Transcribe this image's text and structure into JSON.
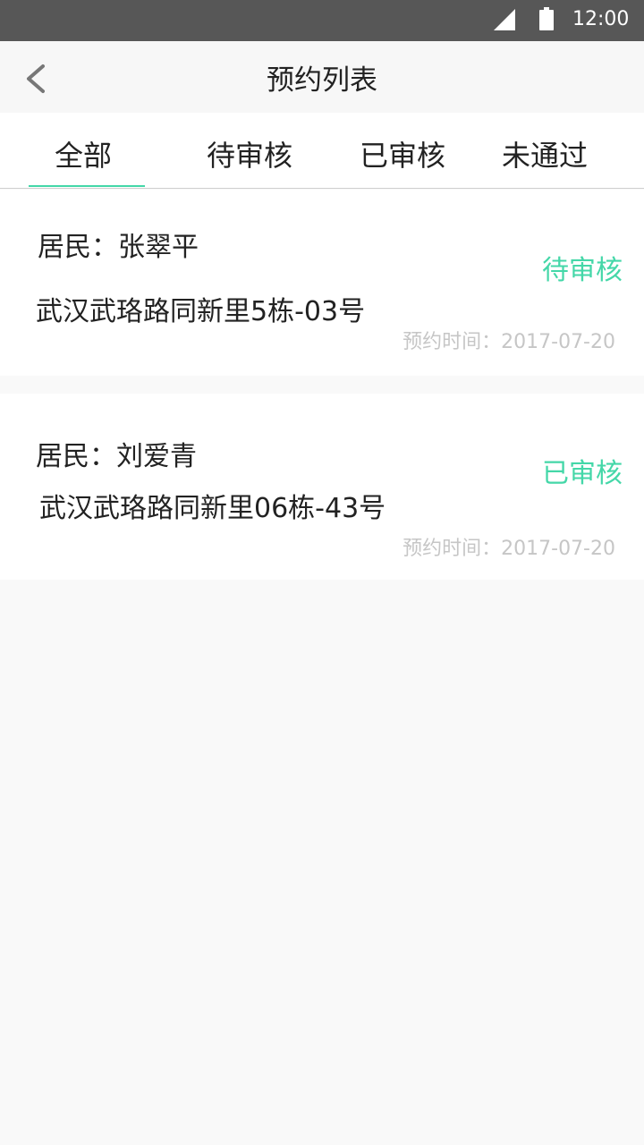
{
  "status_bar": {
    "time": "12:00",
    "icons": [
      "cell-signal-icon",
      "battery-icon"
    ]
  },
  "header": {
    "title": "预约列表",
    "back_icon": "chevron-left-icon"
  },
  "tabs": [
    {
      "label": "全部",
      "selected": true
    },
    {
      "label": "待审核",
      "selected": false
    },
    {
      "label": "已审核",
      "selected": false
    },
    {
      "label": "未通过",
      "selected": false
    }
  ],
  "appointments": [
    {
      "resident": "居民：张翠平",
      "address": "武汉武珞路同新里5栋-03号",
      "status": "待审核",
      "time": "预约时间：2017-07-20"
    },
    {
      "resident": "居民：刘爱青",
      "address": "武汉武珞路同新里06栋-43号",
      "status": "已审核",
      "time": "预约时间：2017-07-20"
    }
  ],
  "colors": {
    "accent": "#44d7a8",
    "status_bar": "#575757",
    "muted_text": "#c6c6c6"
  }
}
